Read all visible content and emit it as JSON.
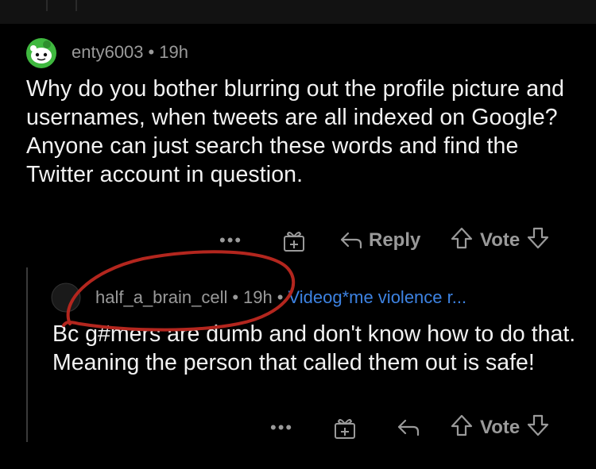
{
  "parent_comment": {
    "username": "enty6003",
    "separator": "•",
    "time": "19h",
    "body": "Why do you bother blurring out the profile picture and usernames, when tweets are all indexed on Google? Anyone can just search these words and find the Twitter account in question.",
    "actions": {
      "more": "•••",
      "reply_label": "Reply",
      "vote_label": "Vote"
    }
  },
  "reply_comment": {
    "username": "half_a_brain_cell",
    "separator": "•",
    "time": "19h",
    "flair": "Videog*me violence r...",
    "body": "Bc g#mers are dumb and don't know how to do that. Meaning the person that called them out is safe!",
    "actions": {
      "more": "•••",
      "vote_label": "Vote"
    }
  },
  "colors": {
    "background": "#000000",
    "meta_text": "#9a9a9a",
    "body_text": "#f2f2f2",
    "flair": "#3d83e3",
    "annotation_circle": "#b3261e",
    "avatar_green": "#3fb83f"
  },
  "icons": [
    "snoo-avatar-icon",
    "award-icon",
    "reply-arrow-icon",
    "upvote-icon",
    "downvote-icon"
  ]
}
